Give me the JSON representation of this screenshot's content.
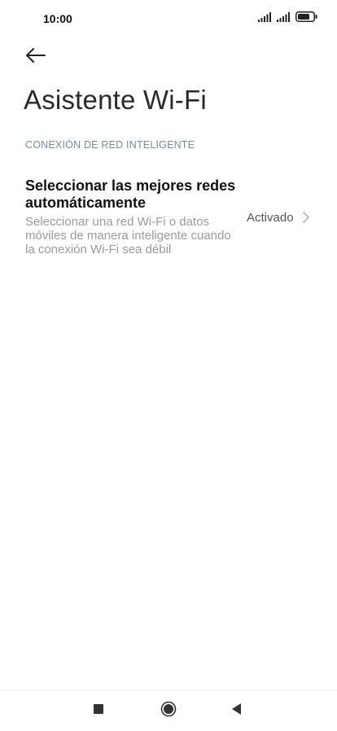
{
  "status_bar": {
    "time": "10:00",
    "icons": [
      "signal-icon",
      "signal-icon",
      "battery-icon"
    ]
  },
  "header": {
    "back_icon": "arrow-left-icon",
    "title": "Asistente Wi-Fi"
  },
  "section": {
    "header": "CONEXIÓN DE RED INTELIGENTE",
    "items": [
      {
        "title": "Seleccionar las mejores redes automáticamente",
        "description": "Seleccionar una red Wi-Fi o datos móviles de manera inteligente cuando la conexión Wi-Fi sea débil",
        "value": "Activado",
        "icon": "chevron-right-icon"
      }
    ]
  },
  "nav_bar": {
    "icons": [
      "recents-square-icon",
      "home-circle-icon",
      "back-triangle-icon"
    ]
  },
  "colors": {
    "section_header": "#7d89a0",
    "description": "#9a9a9a",
    "value": "#555555"
  }
}
